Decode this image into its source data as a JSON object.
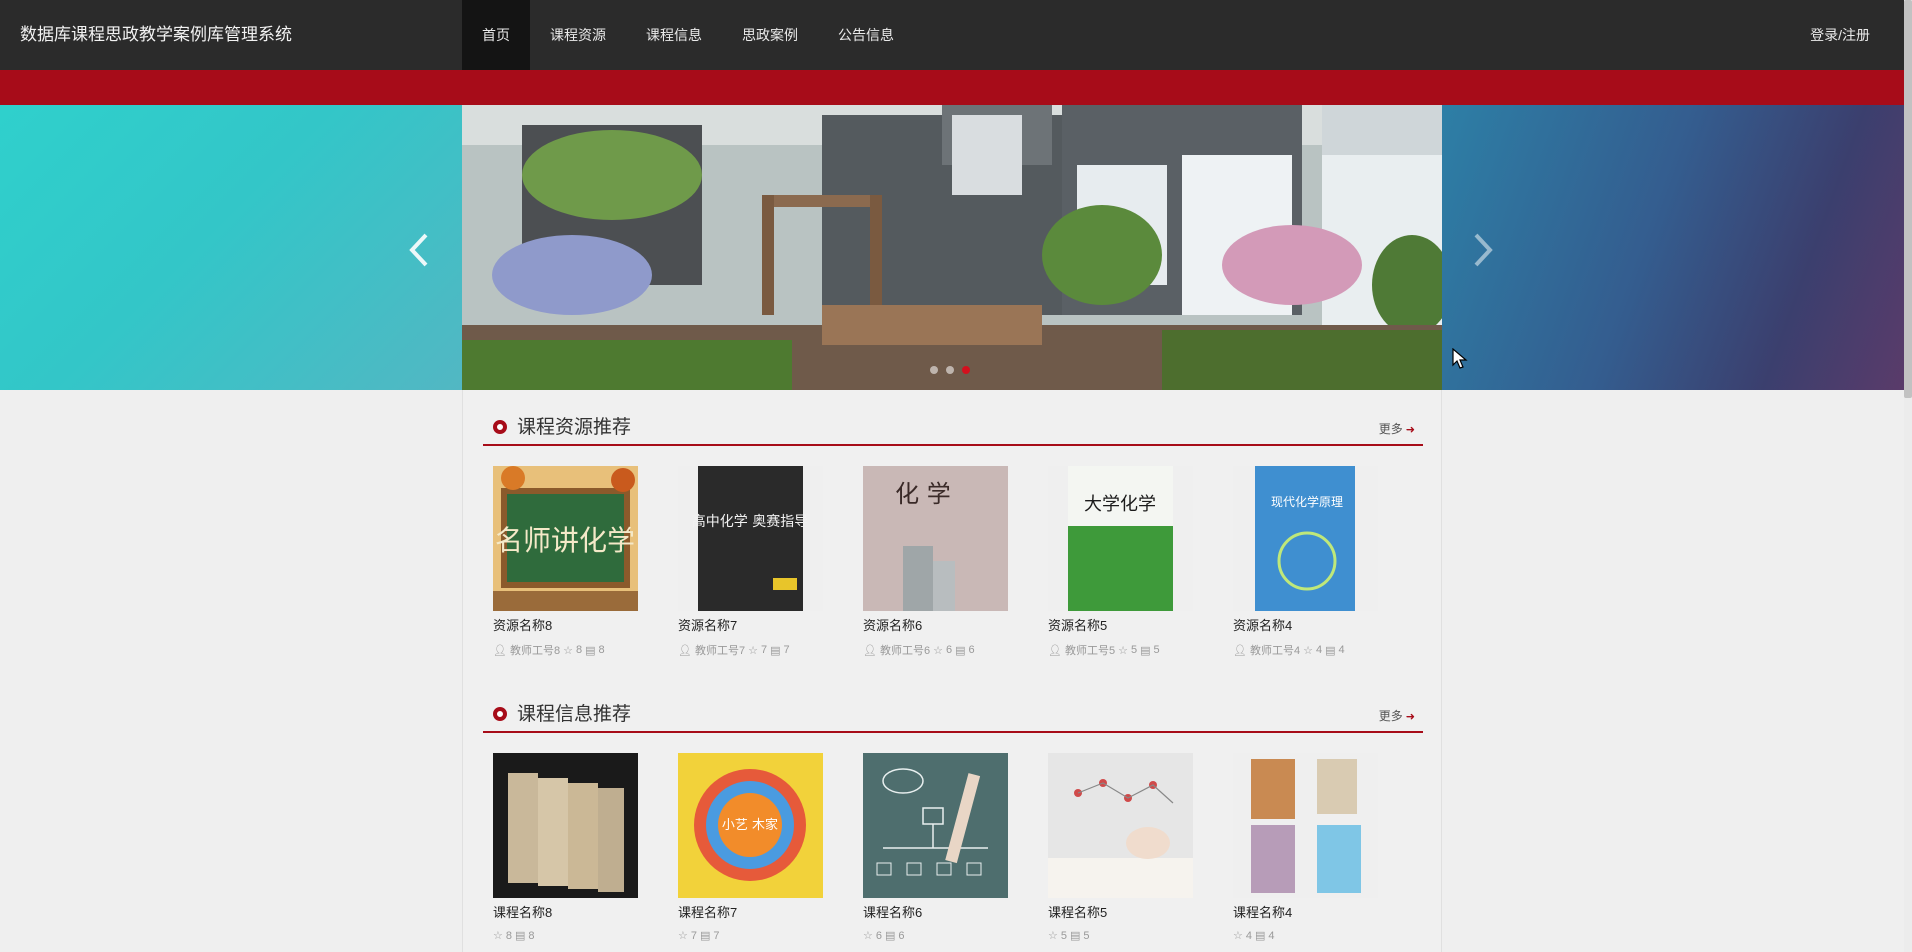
{
  "header": {
    "brand": "数据库课程思政教学案例库管理系统",
    "nav": [
      "首页",
      "课程资源",
      "课程信息",
      "思政案例",
      "公告信息"
    ],
    "active_index": 0,
    "login": "登录/注册"
  },
  "colors": {
    "header_bg": "#2b2b2b",
    "accent_red": "#a70c19",
    "page_bg": "#efefef"
  },
  "banner": {
    "prev_icon": "chevron-left-icon",
    "next_icon": "chevron-right-icon",
    "dots": 3,
    "active_dot": 2
  },
  "sections": [
    {
      "title": "课程资源推荐",
      "more": "更多",
      "items": [
        {
          "title": "资源名称8",
          "author": "教师工号8",
          "stars": "8",
          "comments": "8"
        },
        {
          "title": "资源名称7",
          "author": "教师工号7",
          "stars": "7",
          "comments": "7"
        },
        {
          "title": "资源名称6",
          "author": "教师工号6",
          "stars": "6",
          "comments": "6"
        },
        {
          "title": "资源名称5",
          "author": "教师工号5",
          "stars": "5",
          "comments": "5"
        },
        {
          "title": "资源名称4",
          "author": "教师工号4",
          "stars": "4",
          "comments": "4"
        }
      ],
      "cover_texts": [
        "名师讲化学",
        "高中化学 奥赛指导",
        "化 学",
        "大学化学",
        "现代化学原理"
      ]
    },
    {
      "title": "课程信息推荐",
      "more": "更多",
      "items": [
        {
          "title": "课程名称8",
          "stars": "8",
          "comments": "8"
        },
        {
          "title": "课程名称7",
          "stars": "7",
          "comments": "7"
        },
        {
          "title": "课程名称6",
          "stars": "6",
          "comments": "6"
        },
        {
          "title": "课程名称5",
          "stars": "5",
          "comments": "5"
        },
        {
          "title": "课程名称4",
          "stars": "4",
          "comments": "4"
        }
      ],
      "cover_texts": [
        "小艺 木家"
      ]
    }
  ]
}
